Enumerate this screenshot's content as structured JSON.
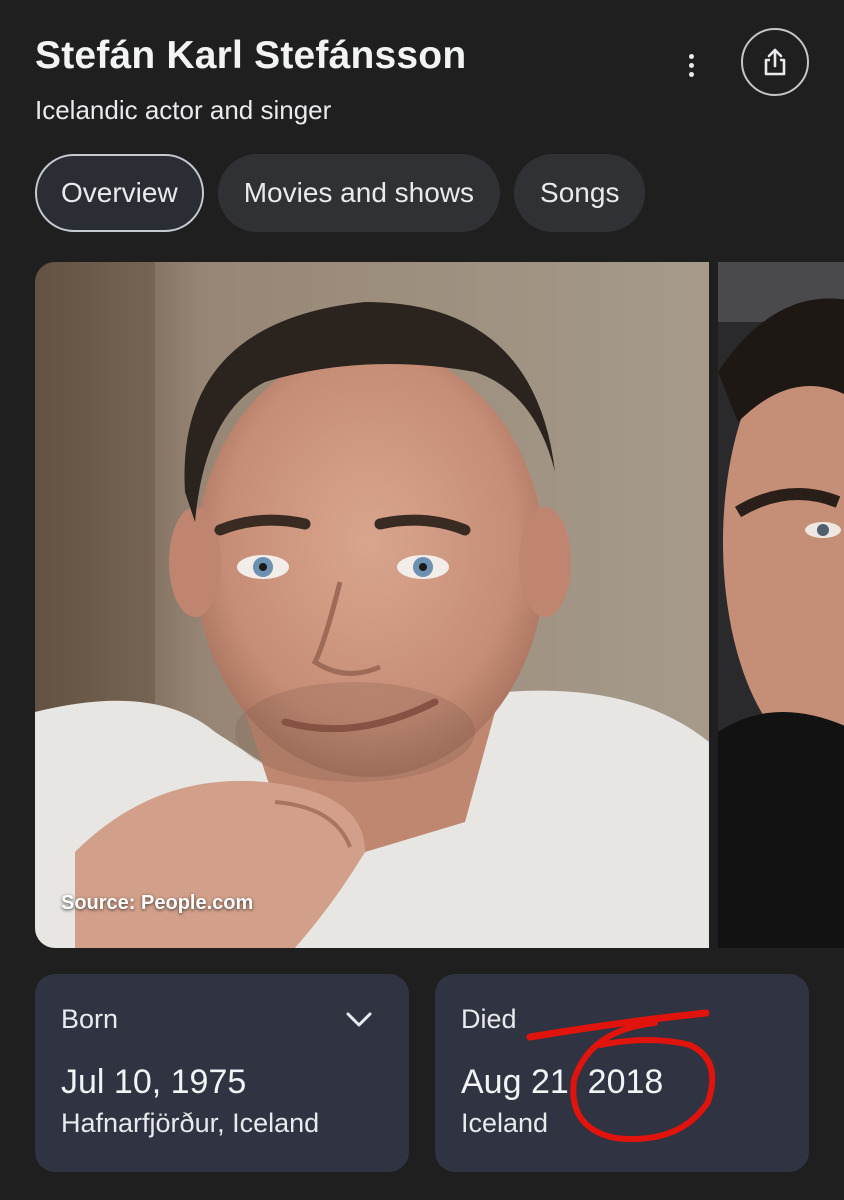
{
  "header": {
    "title": "Stefán Karl Stefánsson",
    "subtitle": "Icelandic actor and singer"
  },
  "icons": {
    "more": "more-vert-icon",
    "share": "share-icon",
    "expand": "chevron-down-icon"
  },
  "tabs": [
    {
      "label": "Overview",
      "active": true
    },
    {
      "label": "Movies and shows",
      "active": false
    },
    {
      "label": "Songs",
      "active": false
    }
  ],
  "gallery": {
    "main_source": "Source: People.com"
  },
  "facts": {
    "born": {
      "label": "Born",
      "date": "Jul 10, 1975",
      "place": "Hafnarfjörður, Iceland"
    },
    "died": {
      "label": "Died",
      "date": "Aug 21, 2018",
      "place": "Iceland"
    }
  },
  "colors": {
    "background": "#1f1f1f",
    "chip": "#303134",
    "card": "#303341",
    "annotation_red": "#e0140c"
  }
}
